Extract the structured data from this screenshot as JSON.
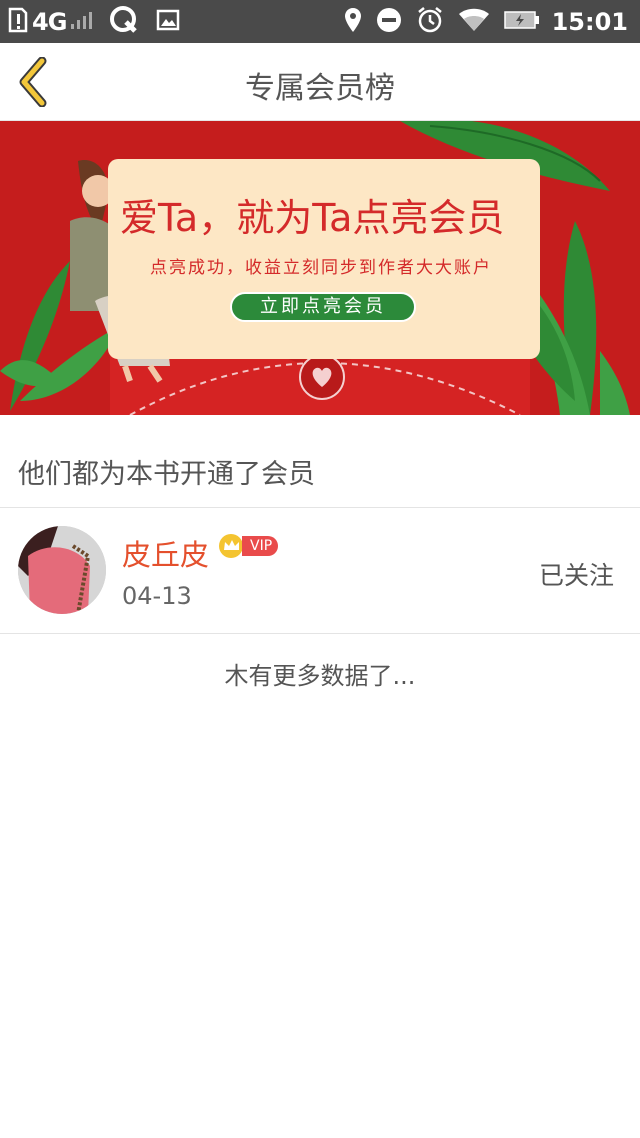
{
  "status_bar": {
    "network": "4G",
    "time": "15:01"
  },
  "header": {
    "title": "专属会员榜"
  },
  "banner": {
    "title": "爱Ta，就为Ta点亮会员",
    "subtitle": "点亮成功，收益立刻同步到作者大大账户",
    "cta": "立即点亮会员"
  },
  "section": {
    "title": "他们都为本书开通了会员"
  },
  "members": [
    {
      "name": "皮丘皮",
      "badge": "VIP",
      "date": "04-13",
      "action": "已关注"
    }
  ],
  "footer": {
    "no_more": "木有更多数据了..."
  },
  "colors": {
    "accent_yellow": "#e8b800",
    "name_red": "#e4502d",
    "banner_red": "#c51d1d",
    "cta_green": "#2c8a3a"
  }
}
